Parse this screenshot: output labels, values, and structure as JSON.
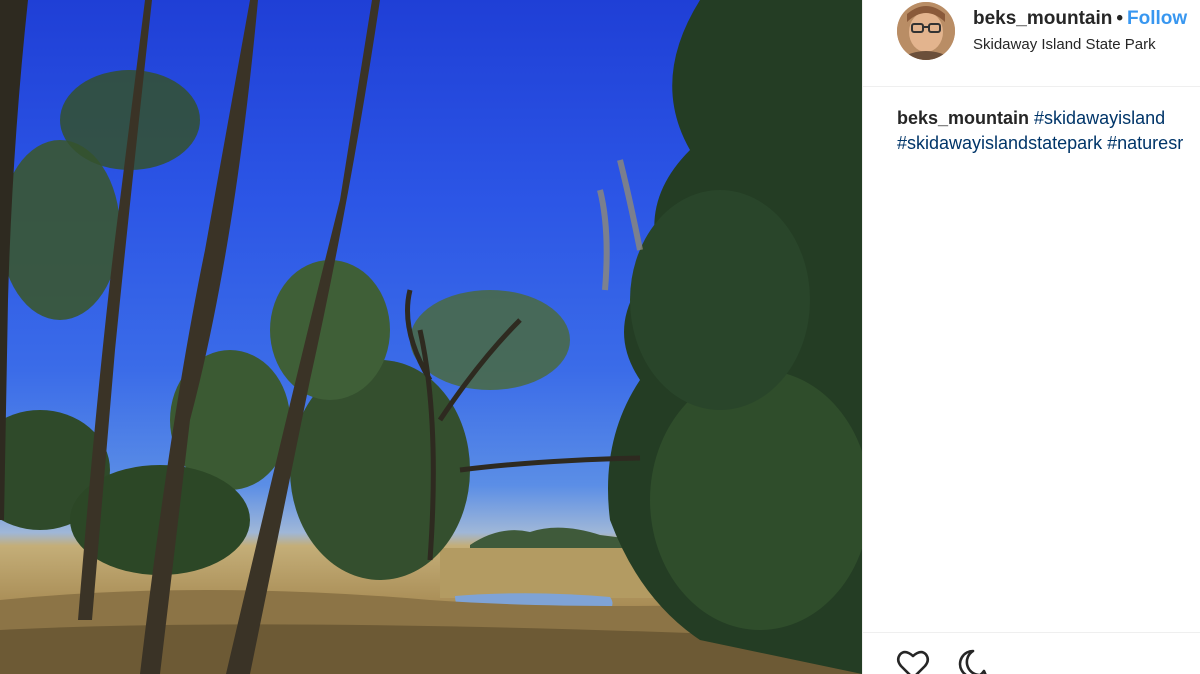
{
  "photo": {
    "icon": "landscape-photo"
  },
  "header": {
    "username": "beks_mountain",
    "separator": "•",
    "follow_label": "Follow",
    "location": "Skidaway Island State Park"
  },
  "caption": {
    "username": "beks_mountain",
    "hashtags": [
      "#skidawayisland",
      "#skidawayislandstatepark",
      "#naturesr"
    ]
  },
  "actions": {
    "like_icon": "heart-icon",
    "comment_icon": "comment-icon"
  },
  "colors": {
    "follow": "#3897f0",
    "hashtag": "#003569",
    "text": "#262626",
    "divider": "#efefef"
  }
}
